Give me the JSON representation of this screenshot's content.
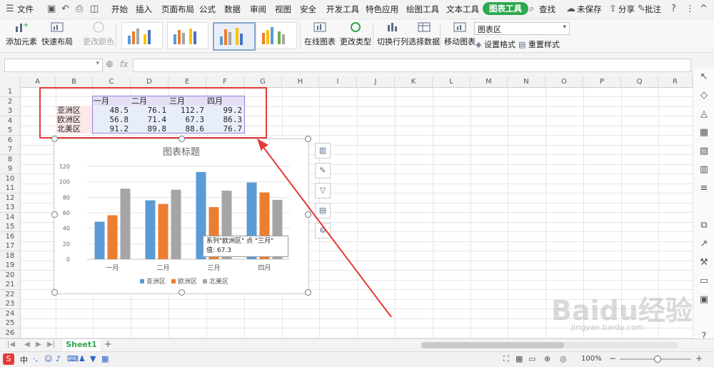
{
  "menubar": {
    "file": "文件",
    "tabs": [
      "开始",
      "插入",
      "页面布局",
      "公式",
      "数据",
      "审阅",
      "视图",
      "安全",
      "开发工具",
      "特色应用",
      "绘图工具",
      "文本工具",
      "图表工具"
    ],
    "search": "查找",
    "unsaved": "未保存",
    "share": "分享",
    "comment": "批注"
  },
  "ribbon": {
    "add_element": "添加元素",
    "quick_layout": "快速布局",
    "change_color": "更改颜色",
    "online_chart": "在线图表",
    "change_type": "更改类型",
    "switch_row_col": "切换行列",
    "select_data": "选择数据",
    "move_chart": "移动图表",
    "element_select": "图表区",
    "format": "设置格式",
    "reset_style": "重置样式"
  },
  "formula": {
    "fx": "fx",
    "name_box": "",
    "value": ""
  },
  "grid": {
    "columns": [
      "A",
      "B",
      "C",
      "D",
      "E",
      "F",
      "G",
      "H",
      "I",
      "J",
      "K",
      "L",
      "M",
      "N",
      "O",
      "P",
      "Q",
      "R"
    ],
    "rows": [
      "1",
      "2",
      "3",
      "4",
      "5",
      "6",
      "7",
      "8",
      "9",
      "10",
      "11",
      "12",
      "13",
      "14",
      "15",
      "16",
      "17",
      "18",
      "19",
      "20",
      "21",
      "22",
      "23",
      "24",
      "25",
      "26"
    ],
    "table": {
      "headers": [
        "一月",
        "二月",
        "三月",
        "四月"
      ],
      "regions": [
        "亚洲区",
        "欧洲区",
        "北美区"
      ],
      "values": [
        [
          "48.5",
          "76.1",
          "112.7",
          "99.2"
        ],
        [
          "56.8",
          "71.4",
          "67.3",
          "86.3"
        ],
        [
          "91.2",
          "89.8",
          "88.6",
          "76.7"
        ]
      ]
    }
  },
  "chart_data": {
    "type": "bar",
    "title": "图表标题",
    "categories": [
      "一月",
      "二月",
      "三月",
      "四月"
    ],
    "series": [
      {
        "name": "亚洲区",
        "values": [
          48.5,
          76.1,
          112.7,
          99.2
        ],
        "color": "#5b9bd5"
      },
      {
        "name": "欧洲区",
        "values": [
          56.8,
          71.4,
          67.3,
          86.3
        ],
        "color": "#ed7d31"
      },
      {
        "name": "北美区",
        "values": [
          91.2,
          89.8,
          88.6,
          76.7
        ],
        "color": "#a5a5a5"
      }
    ],
    "ylim": [
      0,
      120
    ],
    "yticks": [
      "0",
      "20",
      "40",
      "60",
      "80",
      "100",
      "120"
    ],
    "grid": true,
    "legend": "bottom",
    "tooltip": {
      "line1": "系列\"欧洲区\" 点 \"三月\"",
      "line2": "值: 67.3"
    }
  },
  "sheet": {
    "tab": "Sheet1",
    "add": "+"
  },
  "status": {
    "zoom": "100%",
    "watermark": "jingyan.baidu.com",
    "brand": "Baidu经验"
  },
  "colors": {
    "accent": "#2fa84f",
    "selection": "#e53935",
    "table_header": "#e4dff5"
  }
}
